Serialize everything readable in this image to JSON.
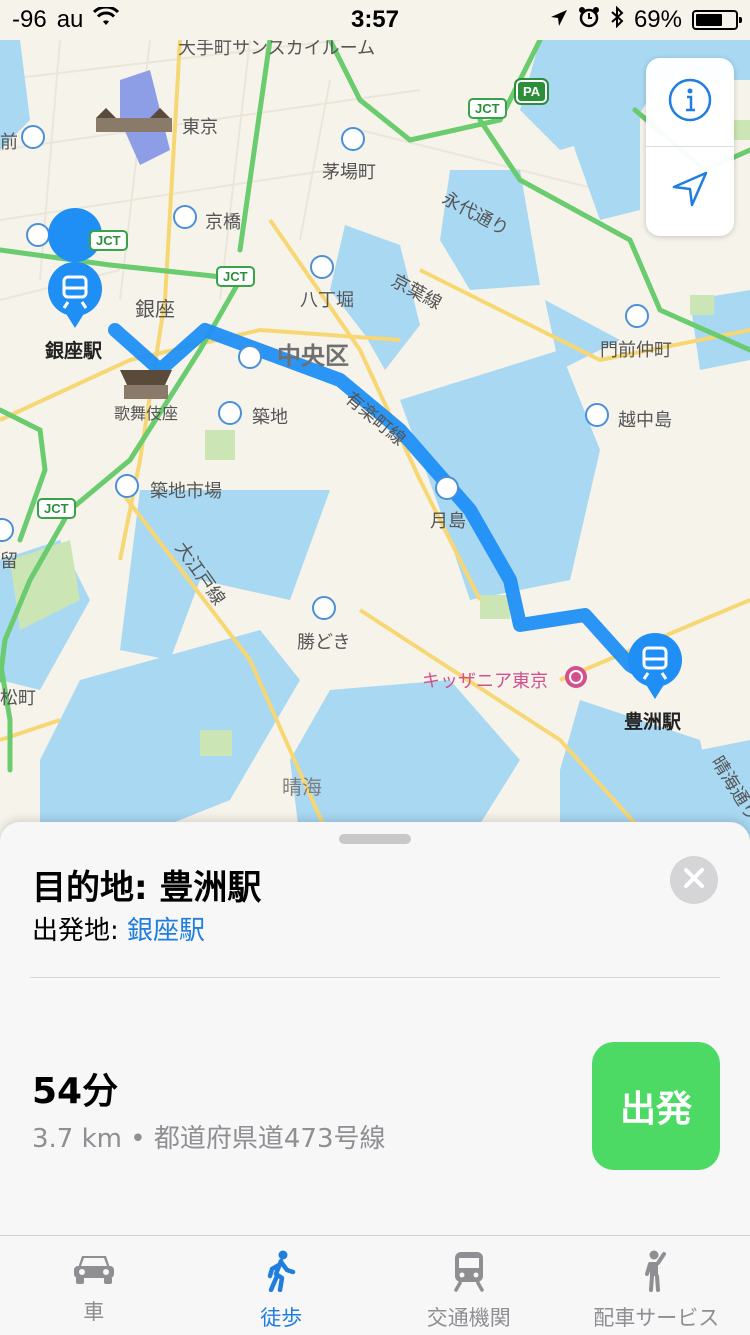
{
  "status_bar": {
    "signal": "-96",
    "carrier": "au",
    "time": "3:57",
    "battery": "69%",
    "battery_level": 0.69,
    "icons": [
      "wifi-icon",
      "location-arrow-icon",
      "alarm-icon",
      "bluetooth-icon",
      "battery-icon"
    ]
  },
  "map": {
    "labels": {
      "tokyo": "東京",
      "top_poi": "大手町サンスカイルーム",
      "kayabacho": "茅場町",
      "kyobashi": "京橋",
      "eitai": "永代通り",
      "hatchobori": "八丁堀",
      "keiyo": "京葉線",
      "ginza": "銀座",
      "ginza_station": "銀座駅",
      "chuoku": "中央区",
      "monzen": "門前仲町",
      "kabukiza": "歌舞伎座",
      "tsukiji": "築地",
      "yurakucho": "有楽町線",
      "etchujima": "越中島",
      "tsukiji_market": "築地市場",
      "tsukishima": "月島",
      "oedo": "大江戸線",
      "kachidoki": "勝どき",
      "kidzania": "キッザニア東京",
      "toyosu_station": "豊洲駅",
      "harumi": "晴海",
      "harumi_dori": "晴海通り",
      "edge_mae": "前",
      "edge_ryu": "留",
      "edge_matsu": "松町"
    },
    "badges": {
      "jct": "JCT",
      "pa": "PA"
    },
    "colors": {
      "route": "#1f8ff5",
      "water": "#a8d8f2",
      "land": "#f6f3ea",
      "expressway": "#6acb6f",
      "major_road": "#f7d774",
      "pin": "#1f8ff5"
    },
    "controls": [
      "info-icon",
      "location-arrow-icon"
    ]
  },
  "sheet": {
    "destination_label": "目的地: 豊洲駅",
    "origin_prefix": "出発地: ",
    "origin_value": "銀座駅",
    "duration": "54分",
    "route_detail": "3.7 km • 都道府県道473号線",
    "go_button": "出発"
  },
  "tab_bar": {
    "items": [
      {
        "label": "車",
        "icon": "car-icon",
        "active": false
      },
      {
        "label": "徒歩",
        "icon": "walking-icon",
        "active": true
      },
      {
        "label": "交通機関",
        "icon": "train-icon",
        "active": false
      },
      {
        "label": "配車サービス",
        "icon": "person-hailing-icon",
        "active": false
      }
    ]
  }
}
